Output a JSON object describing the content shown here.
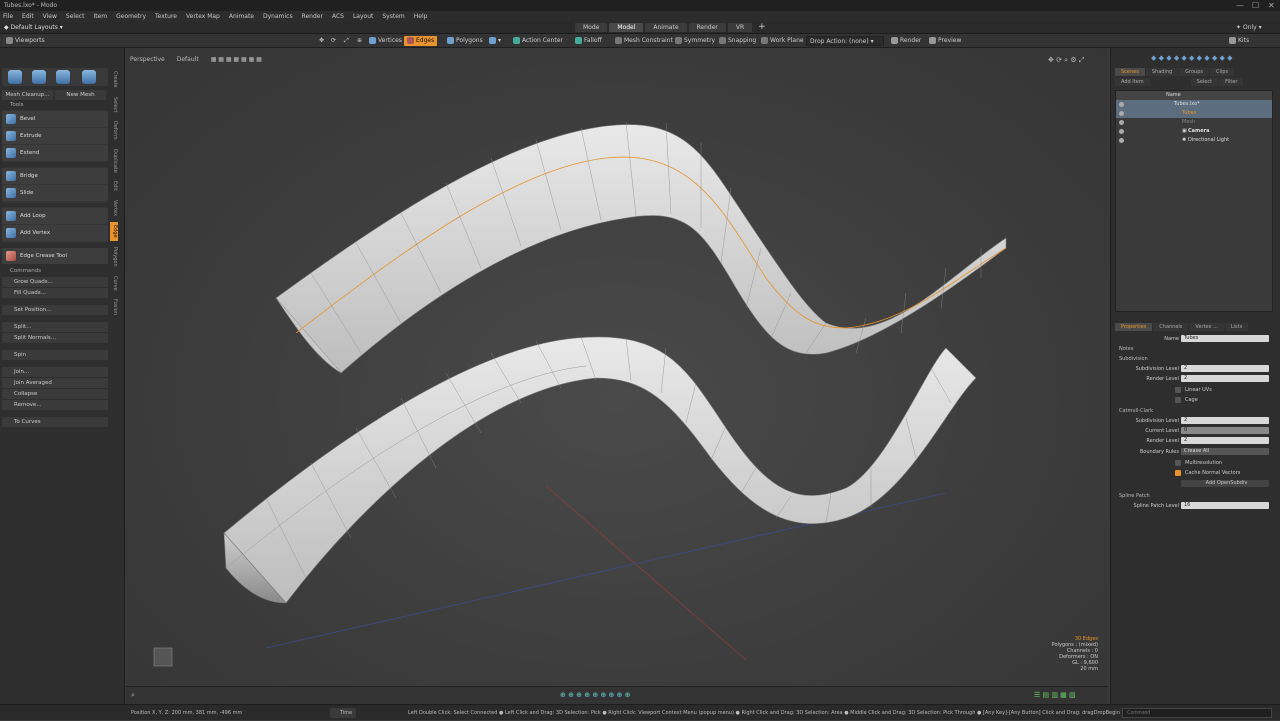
{
  "window": {
    "title": "Tubes.lxo* - Modo"
  },
  "menu": [
    "File",
    "Edit",
    "View",
    "Select",
    "Item",
    "Geometry",
    "Texture",
    "Vertex Map",
    "Animate",
    "Dynamics",
    "Render",
    "ACS",
    "Layout",
    "System",
    "Help"
  ],
  "layout": {
    "selected": "Default Layouts",
    "tabs": [
      "Mode",
      "Model",
      "Animate",
      "Render",
      "VR"
    ],
    "active_tab": "Model",
    "only_label": "Only"
  },
  "toolbar": {
    "viewports": "Viewports",
    "vertices": "Vertices",
    "edges": "Edges",
    "polygons": "Polygons",
    "action_center": "Action Center",
    "falloff": "Falloff",
    "mesh_constraint": "Mesh Constraint",
    "symmetry": "Symmetry",
    "snapping": "Snapping",
    "work_plane": "Work Plane",
    "drop_action": "Drop Action: (none)",
    "render": "Render",
    "preview": "Preview",
    "kits": "Kits"
  },
  "left": {
    "mesh_cleanup": "Mesh Cleanup...",
    "new_mesh": "New Mesh",
    "tools_label": "Tools",
    "tools": [
      "Bevel",
      "Extrude",
      "Extend",
      "Bridge",
      "Slide",
      "Add Loop",
      "Add Vertex",
      "Edge Crease Tool"
    ],
    "commands_label": "Commands",
    "commands": [
      "Grow Quads...",
      "Fill Quads...",
      "Set Position...",
      "Split...",
      "Split Normals...",
      "Spin",
      "Join...",
      "Join Averaged",
      "Collapse",
      "Remove...",
      "To Curves"
    ],
    "vtabs": [
      "Create",
      "Select",
      "Deform",
      "Duplicate",
      "Edit",
      "Vertex",
      "Edge",
      "Polygon",
      "Curve",
      "Fusion"
    ],
    "active_vtab": "Edge"
  },
  "viewport": {
    "view": "Perspective",
    "shading": "Default",
    "info": {
      "edges": "30 Edges",
      "polygons": "Polygons : (mixed)",
      "channels": "Channels : 0",
      "deformers": "Deformers : ON",
      "gl": "GL : 9,600",
      "scale": "20 mm"
    }
  },
  "scene": {
    "tabs": [
      "Scenes",
      "Shading",
      "Groups",
      "Clips"
    ],
    "add_item": "Add Item",
    "select": "Select",
    "filter": "Filter",
    "name_col": "Name",
    "items": [
      {
        "label": "Tubes.lxo*",
        "indent": 1,
        "selected": true
      },
      {
        "label": "Tubes",
        "indent": 2,
        "selected": true
      },
      {
        "label": "Mesh",
        "indent": 2,
        "selected": false
      },
      {
        "label": "Camera",
        "indent": 2,
        "selected": false
      },
      {
        "label": "Directional Light",
        "indent": 2,
        "selected": false
      }
    ]
  },
  "properties": {
    "tabs": [
      "Properties",
      "Channels",
      "Vertex ...",
      "Lists"
    ],
    "name_label": "Name",
    "name_value": "Tubes",
    "notes": "Notes",
    "subdivision": "Subdivision",
    "subdivision_level_label": "Subdivision Level",
    "subdivision_level": "2",
    "render_level_label": "Render Level",
    "render_level": "2",
    "linear_uvs": "Linear UVs",
    "cage": "Cage",
    "catmull": "Catmull-Clark",
    "cc_subdivision_level": "2",
    "current_level_label": "Current Level",
    "current_level": "0",
    "cc_render_level": "2",
    "boundary_rules_label": "Boundary Rules",
    "boundary_rules": "Crease All",
    "multiresolution": "Multiresolution",
    "cache_normal": "Cache Normal Vectors",
    "add_opensubdiv": "Add OpenSubdiv",
    "spline_patch": "Spline Patch",
    "spline_patch_level_label": "Spline Patch Level",
    "spline_patch_level": "16"
  },
  "status": {
    "position": "Position X, Y, Z:   200 mm, 381 mm, -496 mm",
    "time": "Time",
    "hint": "Left Double Click: Select Connected ● Left Click and Drag: 3D Selection: Pick ● Right Click: Viewport Context Menu (popup menu) ● Right Click and Drag: 3D Selection: Area ● Middle Click and Drag: 3D Selection: Pick Through ● [Any Key]-[Any Button] Click and Drag: dragDropBegin",
    "command_placeholder": "Command"
  }
}
